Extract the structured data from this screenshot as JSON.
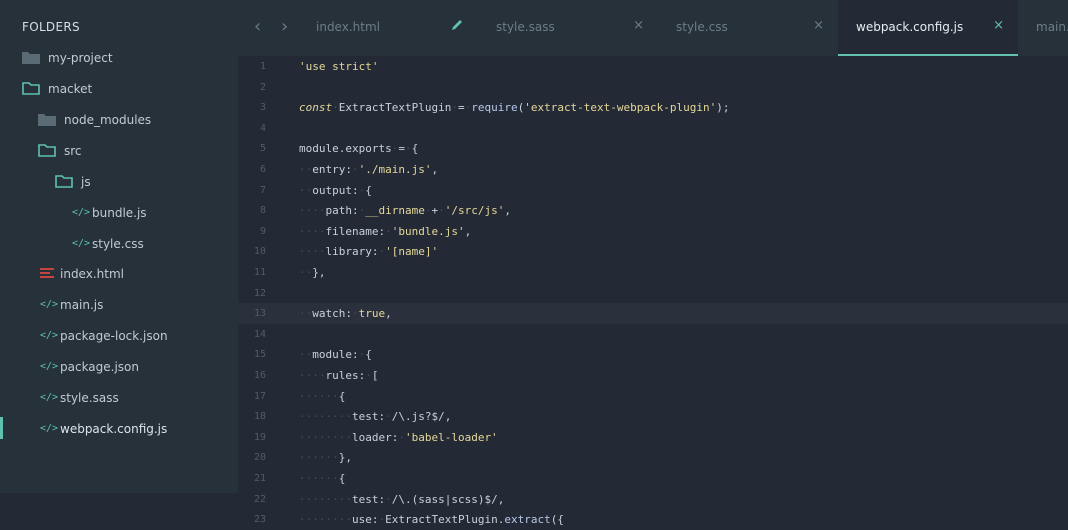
{
  "sidebar": {
    "title": "FOLDERS",
    "items": [
      {
        "label": "my-project",
        "icon": "folder-closed-icon"
      },
      {
        "label": "macket",
        "icon": "folder-open-icon"
      },
      {
        "label": "node_modules",
        "icon": "folder-closed-icon"
      },
      {
        "label": "src",
        "icon": "folder-open-icon"
      },
      {
        "label": "js",
        "icon": "folder-open-icon"
      },
      {
        "label": "bundle.js",
        "icon": "code-file-icon"
      },
      {
        "label": "style.css",
        "icon": "code-file-icon"
      },
      {
        "label": "index.html",
        "icon": "html-file-icon"
      },
      {
        "label": "main.js",
        "icon": "code-file-icon"
      },
      {
        "label": "package-lock.json",
        "icon": "code-file-icon"
      },
      {
        "label": "package.json",
        "icon": "code-file-icon"
      },
      {
        "label": "style.sass",
        "icon": "code-file-icon"
      },
      {
        "label": "webpack.config.js",
        "icon": "code-file-icon",
        "active": true
      }
    ]
  },
  "tabs": [
    {
      "label": "index.html",
      "state": "modified"
    },
    {
      "label": "style.sass",
      "state": "closable"
    },
    {
      "label": "style.css",
      "state": "closable"
    },
    {
      "label": "webpack.config.js",
      "state": "active"
    },
    {
      "label": "main.js",
      "state": "partial"
    }
  ],
  "icons": {
    "close": "×",
    "code": "</>",
    "nav_back": "‹",
    "nav_forward": "›"
  },
  "colors": {
    "accent": "#5fc2b0",
    "html_icon": "#c5443f",
    "string": "#e5d79a"
  },
  "editor": {
    "highlighted_line": 13,
    "lines": [
      {
        "n": "1",
        "segs": [
          {
            "t": "'use strict'",
            "c": "str"
          }
        ]
      },
      {
        "n": "2",
        "segs": []
      },
      {
        "n": "3",
        "segs": [
          {
            "t": "const",
            "c": "kw"
          },
          {
            "t": "·",
            "c": "ws"
          },
          {
            "t": "ExtractTextPlugin"
          },
          {
            "t": "·",
            "c": "ws"
          },
          {
            "t": "="
          },
          {
            "t": "·",
            "c": "ws"
          },
          {
            "t": "require",
            "c": "fn"
          },
          {
            "t": "("
          },
          {
            "t": "'extract-text-webpack-plugin'",
            "c": "str"
          },
          {
            "t": ");"
          }
        ]
      },
      {
        "n": "4",
        "segs": []
      },
      {
        "n": "5",
        "segs": [
          {
            "t": "module.exports"
          },
          {
            "t": "·",
            "c": "ws"
          },
          {
            "t": "="
          },
          {
            "t": "·",
            "c": "ws"
          },
          {
            "t": "{"
          }
        ]
      },
      {
        "n": "6",
        "segs": [
          {
            "t": "··",
            "c": "ws"
          },
          {
            "t": "entry:"
          },
          {
            "t": "·",
            "c": "ws"
          },
          {
            "t": "'./main.js'",
            "c": "str"
          },
          {
            "t": ","
          }
        ]
      },
      {
        "n": "7",
        "segs": [
          {
            "t": "··",
            "c": "ws"
          },
          {
            "t": "output:"
          },
          {
            "t": "·",
            "c": "ws"
          },
          {
            "t": "{"
          }
        ]
      },
      {
        "n": "8",
        "segs": [
          {
            "t": "····",
            "c": "ws"
          },
          {
            "t": "path:"
          },
          {
            "t": "·",
            "c": "ws"
          },
          {
            "t": "__dirname",
            "c": "str"
          },
          {
            "t": "·",
            "c": "ws"
          },
          {
            "t": "+"
          },
          {
            "t": "·",
            "c": "ws"
          },
          {
            "t": "'/src/js'",
            "c": "str"
          },
          {
            "t": ","
          }
        ]
      },
      {
        "n": "9",
        "segs": [
          {
            "t": "····",
            "c": "ws"
          },
          {
            "t": "filename:"
          },
          {
            "t": "·",
            "c": "ws"
          },
          {
            "t": "'bundle.js'",
            "c": "str"
          },
          {
            "t": ","
          }
        ]
      },
      {
        "n": "10",
        "segs": [
          {
            "t": "····",
            "c": "ws"
          },
          {
            "t": "library:"
          },
          {
            "t": "·",
            "c": "ws"
          },
          {
            "t": "'[name]'",
            "c": "str"
          }
        ]
      },
      {
        "n": "11",
        "segs": [
          {
            "t": "··",
            "c": "ws"
          },
          {
            "t": "},"
          }
        ]
      },
      {
        "n": "12",
        "segs": []
      },
      {
        "n": "13",
        "segs": [
          {
            "t": "··",
            "c": "ws"
          },
          {
            "t": "watch:"
          },
          {
            "t": "·",
            "c": "ws"
          },
          {
            "t": "true",
            "c": "bool"
          },
          {
            "t": ","
          }
        ]
      },
      {
        "n": "14",
        "segs": []
      },
      {
        "n": "15",
        "segs": [
          {
            "t": "··",
            "c": "ws"
          },
          {
            "t": "module:"
          },
          {
            "t": "·",
            "c": "ws"
          },
          {
            "t": "{"
          }
        ]
      },
      {
        "n": "16",
        "segs": [
          {
            "t": "····",
            "c": "ws"
          },
          {
            "t": "rules:"
          },
          {
            "t": "·",
            "c": "ws"
          },
          {
            "t": "["
          }
        ]
      },
      {
        "n": "17",
        "segs": [
          {
            "t": "······",
            "c": "ws"
          },
          {
            "t": "{"
          }
        ]
      },
      {
        "n": "18",
        "segs": [
          {
            "t": "········",
            "c": "ws"
          },
          {
            "t": "test:"
          },
          {
            "t": "·",
            "c": "ws"
          },
          {
            "t": "/\\.js?$/",
            "c": "re"
          },
          {
            "t": ","
          }
        ]
      },
      {
        "n": "19",
        "segs": [
          {
            "t": "········",
            "c": "ws"
          },
          {
            "t": "loader:"
          },
          {
            "t": "·",
            "c": "ws"
          },
          {
            "t": "'babel-loader'",
            "c": "str"
          }
        ]
      },
      {
        "n": "20",
        "segs": [
          {
            "t": "······",
            "c": "ws"
          },
          {
            "t": "},"
          }
        ]
      },
      {
        "n": "21",
        "segs": [
          {
            "t": "······",
            "c": "ws"
          },
          {
            "t": "{"
          }
        ]
      },
      {
        "n": "22",
        "segs": [
          {
            "t": "········",
            "c": "ws"
          },
          {
            "t": "test:"
          },
          {
            "t": "·",
            "c": "ws"
          },
          {
            "t": "/\\.(sass|scss)$/",
            "c": "re"
          },
          {
            "t": ","
          }
        ]
      },
      {
        "n": "23",
        "segs": [
          {
            "t": "········",
            "c": "ws"
          },
          {
            "t": "use:"
          },
          {
            "t": "·",
            "c": "ws"
          },
          {
            "t": "ExtractTextPlugin"
          },
          {
            "t": "."
          },
          {
            "t": "extract",
            "c": "fn"
          },
          {
            "t": "({"
          }
        ]
      }
    ]
  }
}
